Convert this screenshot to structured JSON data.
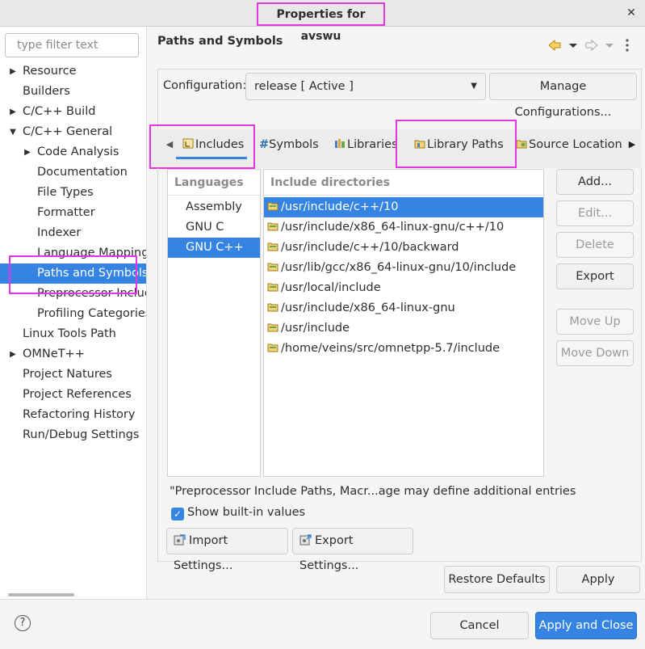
{
  "window": {
    "title": "Properties for avswu",
    "close": "✕"
  },
  "filter": {
    "placeholder": "type filter text"
  },
  "tree": [
    {
      "label": "Resource",
      "expander": "▶"
    },
    {
      "label": "Builders",
      "expander": ""
    },
    {
      "label": "C/C++ Build",
      "expander": "▶"
    },
    {
      "label": "C/C++ General",
      "expander": "▼"
    },
    {
      "label": "Code Analysis",
      "expander": "▶"
    },
    {
      "label": "Documentation",
      "expander": ""
    },
    {
      "label": "File Types",
      "expander": ""
    },
    {
      "label": "Formatter",
      "expander": ""
    },
    {
      "label": "Indexer",
      "expander": ""
    },
    {
      "label": "Language Mappings",
      "expander": ""
    },
    {
      "label": "Paths and Symbols",
      "expander": ""
    },
    {
      "label": "Preprocessor Include Paths, Macros etc.",
      "expander": ""
    },
    {
      "label": "Profiling Categories",
      "expander": ""
    },
    {
      "label": "Linux Tools Path",
      "expander": ""
    },
    {
      "label": "OMNeT++",
      "expander": "▶"
    },
    {
      "label": "Project Natures",
      "expander": ""
    },
    {
      "label": "Project References",
      "expander": ""
    },
    {
      "label": "Refactoring History",
      "expander": ""
    },
    {
      "label": "Run/Debug Settings",
      "expander": ""
    }
  ],
  "page": {
    "title": "Paths and Symbols",
    "config_label": "Configuration:",
    "config_value": "release  [ Active ]",
    "manage_button": "Manage Configurations..."
  },
  "tabs": [
    {
      "label": "Includes"
    },
    {
      "label": "Symbols",
      "prefix": "#"
    },
    {
      "label": "Libraries"
    },
    {
      "label": "Library Paths"
    },
    {
      "label": "Source Location"
    }
  ],
  "languages": {
    "header": "Languages",
    "items": [
      "Assembly",
      "GNU C",
      "GNU C++"
    ]
  },
  "includes": {
    "header": "Include directories",
    "items": [
      "/usr/include/c++/10",
      "/usr/include/x86_64-linux-gnu/c++/10",
      "/usr/include/c++/10/backward",
      "/usr/lib/gcc/x86_64-linux-gnu/10/include",
      "/usr/local/include",
      "/usr/include/x86_64-linux-gnu",
      "/usr/include",
      "/home/veins/src/omnetpp-5.7/include"
    ]
  },
  "side_buttons": {
    "add": "Add...",
    "edit": "Edit...",
    "delete": "Delete",
    "export": "Export",
    "move_up": "Move Up",
    "move_down": "Move Down"
  },
  "note": "\"Preprocessor Include Paths, Macr...age may define additional entries",
  "show_builtin": {
    "label": "Show built-in values",
    "checked": true
  },
  "import_settings": "Import Settings...",
  "export_settings": "Export Settings...",
  "restore_defaults": "Restore Defaults",
  "apply": "Apply",
  "cancel": "Cancel",
  "apply_close": "Apply and Close",
  "help": "?",
  "colors": {
    "accent": "#3584e4",
    "highlight": "#e633e6"
  }
}
